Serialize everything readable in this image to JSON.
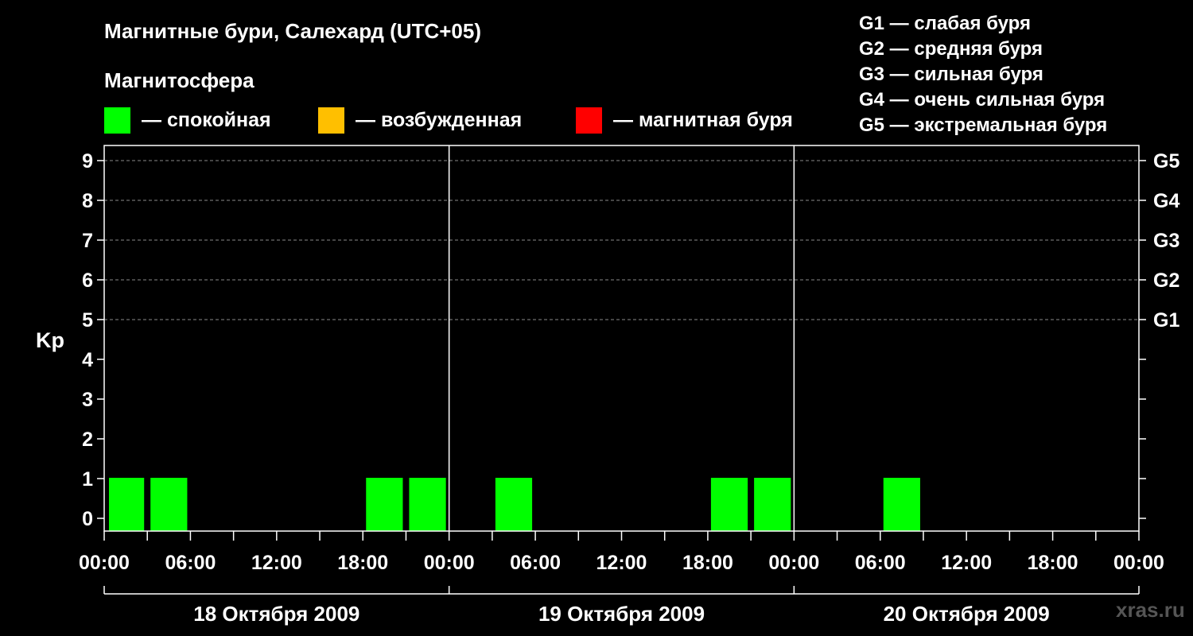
{
  "title": "Магнитные бури, Салехард (UTC+05)",
  "legend": {
    "heading": "Магнитосфера",
    "items": [
      {
        "label": "— спокойная",
        "color": "#00ff00"
      },
      {
        "label": "— возбужденная",
        "color": "#ffbf00"
      },
      {
        "label": "— магнитная буря",
        "color": "#ff0000"
      }
    ]
  },
  "g_scale": [
    "G1 — слабая буря",
    "G2 — средняя буря",
    "G3 — сильная буря",
    "G4 — очень сильная буря",
    "G5 — экстремальная буря"
  ],
  "watermark": "xras.ru",
  "chart_data": {
    "type": "bar",
    "ylabel": "Kp",
    "ylim": [
      0,
      9
    ],
    "yticks": [
      0,
      1,
      2,
      3,
      4,
      5,
      6,
      7,
      8,
      9
    ],
    "right_axis_labels": [
      {
        "kp": 5,
        "label": "G1"
      },
      {
        "kp": 6,
        "label": "G2"
      },
      {
        "kp": 7,
        "label": "G3"
      },
      {
        "kp": 8,
        "label": "G4"
      },
      {
        "kp": 9,
        "label": "G5"
      }
    ],
    "xticks": [
      "00:00",
      "06:00",
      "12:00",
      "18:00",
      "00:00",
      "06:00",
      "12:00",
      "18:00",
      "00:00",
      "06:00",
      "12:00",
      "18:00",
      "00:00"
    ],
    "days": [
      "18 Октября 2009",
      "19 Октября 2009",
      "20 Октября 2009"
    ],
    "grid": "dashed horizontal at Kp 5–9",
    "color_by_level": {
      "quiet": "#00ff00",
      "active": "#ffbf00",
      "storm": "#ff0000"
    },
    "series": [
      {
        "values": [
          {
            "day": "18 Октября 2009",
            "interval": "00:00–03:00",
            "kp": 1,
            "level": "quiet"
          },
          {
            "day": "18 Октября 2009",
            "interval": "03:00–06:00",
            "kp": 1,
            "level": "quiet"
          },
          {
            "day": "18 Октября 2009",
            "interval": "18:00–21:00",
            "kp": 1,
            "level": "quiet"
          },
          {
            "day": "18 Октября 2009",
            "interval": "21:00–00:00",
            "kp": 1,
            "level": "quiet"
          },
          {
            "day": "19 Октября 2009",
            "interval": "03:00–06:00",
            "kp": 1,
            "level": "quiet"
          },
          {
            "day": "19 Октября 2009",
            "interval": "18:00–21:00",
            "kp": 1,
            "level": "quiet"
          },
          {
            "day": "19 Октября 2009",
            "interval": "21:00–00:00",
            "kp": 1,
            "level": "quiet"
          },
          {
            "day": "20 Октября 2009",
            "interval": "06:00–09:00",
            "kp": 1,
            "level": "quiet"
          }
        ]
      }
    ]
  }
}
